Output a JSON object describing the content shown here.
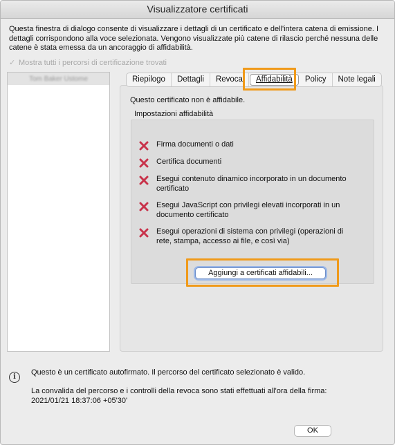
{
  "window": {
    "title": "Visualizzatore certificati"
  },
  "intro": {
    "line1": "Questa finestra di dialogo consente di visualizzare i dettagli di un certificato e dell'intera catena di emissione. I",
    "line2": "dettagli corrispondono alla voce selezionata. Vengono visualizzate più catene di rilascio perché nessuna delle",
    "line3": "catene è stata emessa da un ancoraggio di affidabilità."
  },
  "show_all": {
    "label": "Mostra tutti i percorsi di certificazione trovati",
    "checked": true,
    "disabled": true
  },
  "cert_list": {
    "selected_item": "Tom Baker Ustome"
  },
  "tabs": [
    {
      "label": "Riepilogo"
    },
    {
      "label": "Dettagli"
    },
    {
      "label": "Revoca"
    },
    {
      "label": "Affidabilità",
      "active": true
    },
    {
      "label": "Policy"
    },
    {
      "label": "Note legali"
    }
  ],
  "trust": {
    "status": "Questo certificato non è affidabile.",
    "group_label": "Impostazioni affidabilità",
    "items": [
      {
        "icon": "red-x-icon",
        "line1": "Firma documenti o dati",
        "line2": ""
      },
      {
        "icon": "red-x-icon",
        "line1": "Certifica documenti",
        "line2": ""
      },
      {
        "icon": "red-x-icon",
        "line1": "Esegui contenuto dinamico incorporato in un documento",
        "line2": "certificato"
      },
      {
        "icon": "red-x-icon",
        "line1": "Esegui JavaScript con privilegi elevati incorporati in un",
        "line2": "documento certificato"
      },
      {
        "icon": "red-x-icon",
        "line1": "Esegui operazioni di sistema con privilegi (operazioni di",
        "line2": "rete, stampa, accesso ai file, e così via)"
      }
    ],
    "add_button": "Aggiungi a certificati affidabili..."
  },
  "info": {
    "icon": "info-icon",
    "line1": "Questo è un certificato autofirmato. Il percorso del certificato selezionato è valido.",
    "line2": "La convalida del percorso e i controlli della revoca sono stati effettuati all'ora della firma:",
    "line3": "2021/01/21 18:37:06 +05'30'"
  },
  "ok_button": "OK",
  "colors": {
    "highlight": "#f09a1a",
    "error_x": "#c8324a",
    "focus_ring": "#9bb8e8"
  }
}
